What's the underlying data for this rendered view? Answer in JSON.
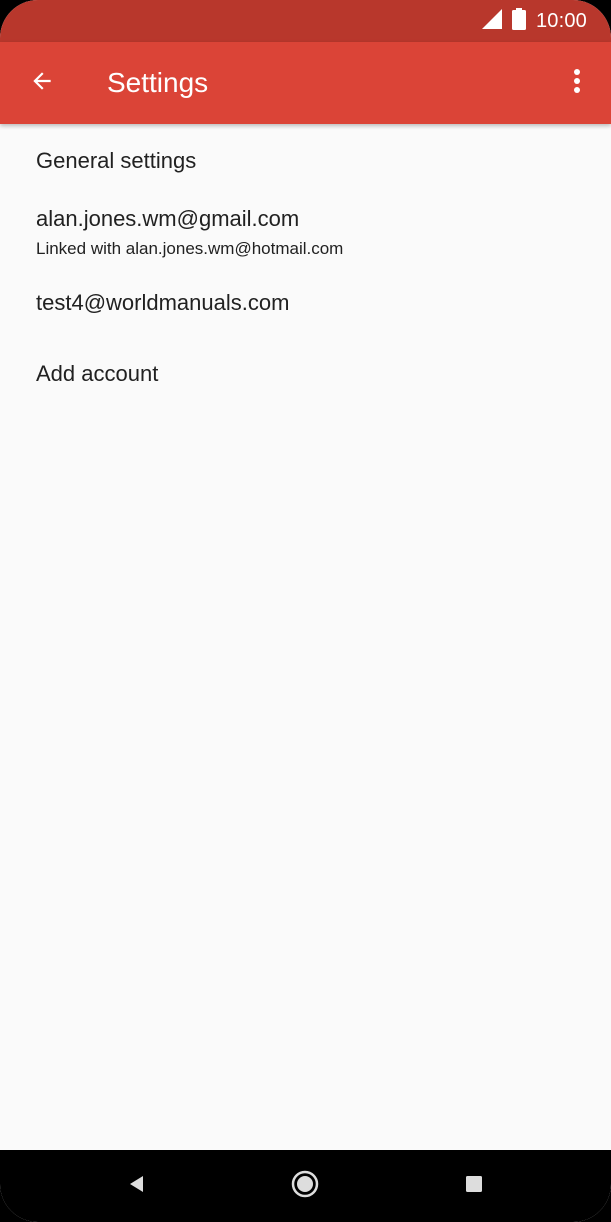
{
  "status_bar": {
    "time": "10:00",
    "icons": [
      "signal-icon",
      "battery-icon"
    ],
    "color": "#b8372c"
  },
  "app_bar": {
    "title": "Settings",
    "back_icon": "arrow-back-icon",
    "menu_icon": "more-vert-icon",
    "color": "#db4437"
  },
  "settings": {
    "general": "General settings",
    "account1": {
      "email": "alan.jones.wm@gmail.com",
      "linked": "Linked with alan.jones.wm@hotmail.com"
    },
    "account2": {
      "email": "test4@worldmanuals.com"
    },
    "add_account": "Add account"
  },
  "nav_bar": {
    "icons": [
      "back-triangle-icon",
      "home-circle-icon",
      "recents-square-icon"
    ]
  }
}
